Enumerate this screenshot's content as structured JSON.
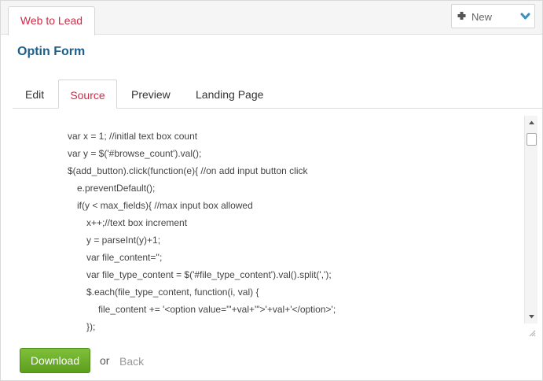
{
  "header": {
    "tab_label": "Web to Lead",
    "new_button_label": "New"
  },
  "page": {
    "title": "Optin Form"
  },
  "tabs": [
    {
      "label": "Edit",
      "active": false
    },
    {
      "label": "Source",
      "active": true
    },
    {
      "label": "Preview",
      "active": false
    },
    {
      "label": "Landing Page",
      "active": false
    }
  ],
  "source_code": {
    "lines": [
      {
        "text": "var x = 1; //initlal text box count",
        "indent": 0
      },
      {
        "text": "var y = $('#browse_count').val();",
        "indent": 0
      },
      {
        "text": "$(add_button).click(function(e){ //on add input button click",
        "indent": 0
      },
      {
        "text": "e.preventDefault();",
        "indent": 1
      },
      {
        "text": "if(y < max_fields){ //max input box allowed",
        "indent": 1
      },
      {
        "text": "x++;//text box increment",
        "indent": 2
      },
      {
        "text": "y = parseInt(y)+1;",
        "indent": 2
      },
      {
        "text": "var file_content='';",
        "indent": 2
      },
      {
        "text": "var file_type_content = $('#file_type_content').val().split(',');",
        "indent": 2
      },
      {
        "text": "$.each(file_type_content, function(i, val) {",
        "indent": 2
      },
      {
        "text": "file_content += '<option value=\"'+val+'\">'+val+'</option>';",
        "indent": 3
      },
      {
        "text": "});",
        "indent": 2
      }
    ]
  },
  "footer": {
    "download_label": "Download",
    "or_text": "or",
    "back_label": "Back"
  },
  "colors": {
    "accent_red": "#d12a47",
    "title_blue": "#1d5e8a",
    "download_green": "#6aaf28",
    "chevron_blue": "#3b8fc4"
  },
  "icons": {
    "new_button": "plus-icon",
    "dropdown": "chevron-down-icon"
  }
}
